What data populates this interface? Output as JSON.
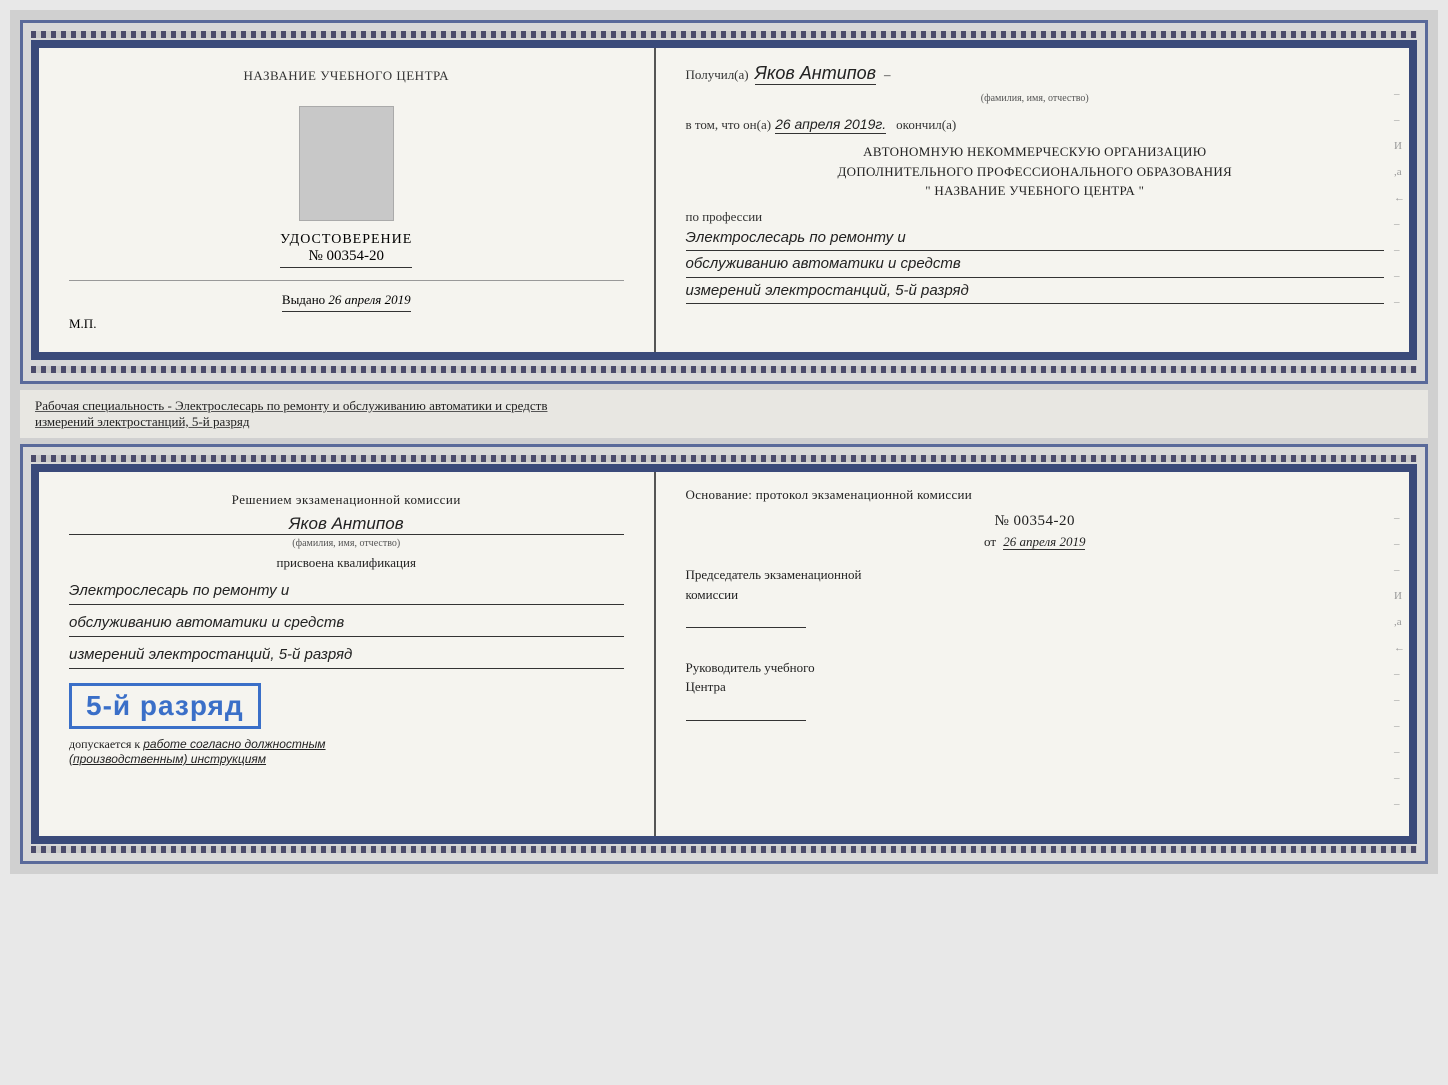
{
  "top_cert": {
    "left": {
      "center_title": "НАЗВАНИЕ УЧЕБНОГО ЦЕНТРА",
      "udostoverenie_label": "УДОСТОВЕРЕНИЕ",
      "number": "№ 00354-20",
      "vydano_label": "Выдано",
      "vydano_date": "26 апреля 2019",
      "mp_label": "М.П."
    },
    "right": {
      "poluchil_label": "Получил(а)",
      "fio_handwritten": "Яков Антипов",
      "fio_sub": "(фамилия, имя, отчество)",
      "vtom_label": "в том, что он(а)",
      "date_handwritten": "26 апреля 2019г.",
      "okончил_label": "окончил(а)",
      "org_line1": "АВТОНОМНУЮ НЕКОММЕРЧЕСКУЮ ОРГАНИЗАЦИЮ",
      "org_line2": "ДОПОЛНИТЕЛЬНОГО ПРОФЕССИОНАЛЬНОГО ОБРАЗОВАНИЯ",
      "org_line3": "\"   НАЗВАНИЕ УЧЕБНОГО ЦЕНТРА   \"",
      "po_professii_label": "по профессии",
      "profession_line1": "Электрослесарь по ремонту и",
      "profession_line2": "обслуживанию автоматики и средств",
      "profession_line3": "измерений электростанций, 5-й разряд"
    }
  },
  "middle_text": {
    "line1": "Рабочая специальность - Электрослесарь по ремонту и обслуживанию автоматики и средств",
    "line2": "измерений электростанций, 5-й разряд"
  },
  "bottom_cert": {
    "left": {
      "decision_title": "Решением экзаменационной комиссии",
      "fio_handwritten": "Яков Антипов",
      "fio_sub": "(фамилия, имя, отчество)",
      "prisvoena_label": "присвоена квалификация",
      "qual_line1": "Электрослесарь по ремонту и",
      "qual_line2": "обслуживанию автоматики и средств",
      "qual_line3": "измерений электростанций, 5-й разряд",
      "razryad_badge": "5-й разряд",
      "dopuskaetsya_prefix": "допускается к",
      "dopuskaetsya_italic": "работе согласно должностным",
      "dopuskaetsya_italic2": "(производственным) инструкциям"
    },
    "right": {
      "osnov_label": "Основание: протокол экзаменационной комиссии",
      "protocol_number": "№  00354-20",
      "protocol_date_prefix": "от",
      "protocol_date": "26 апреля 2019",
      "predsedatel_line1": "Председатель экзаменационной",
      "predsedatel_line2": "комиссии",
      "rukovoditel_line1": "Руководитель учебного",
      "rukovoditel_line2": "Центра"
    }
  }
}
